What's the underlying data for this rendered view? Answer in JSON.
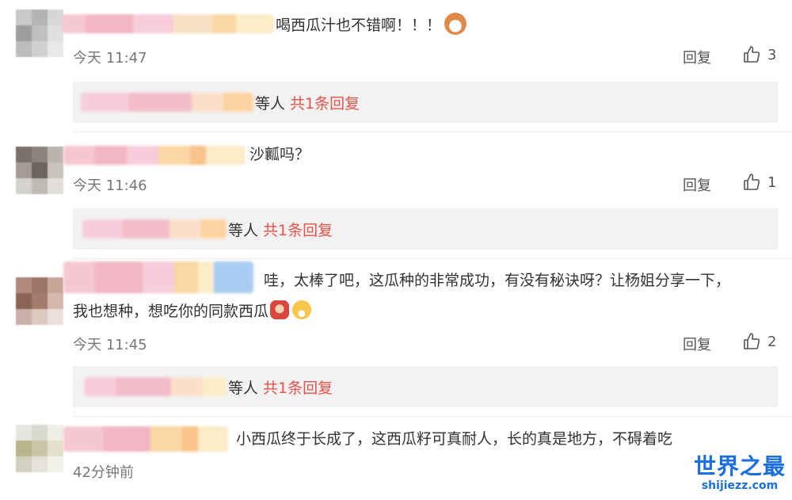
{
  "comments": [
    {
      "text": "喝西瓜汁也不错啊！！！",
      "time": "今天 11:47",
      "reply_label": "回复",
      "likes": "3",
      "emoji": "cat-face",
      "sub": {
        "suffix": "等人 ",
        "link": "共1条回复"
      }
    },
    {
      "text": "沙瓤吗？",
      "time": "今天 11:46",
      "reply_label": "回复",
      "likes": "1",
      "sub": {
        "suffix": "等人 ",
        "link": "共1条回复"
      }
    },
    {
      "text_line1": "哇，太棒了吧，这瓜种的非常成功，有没有秘诀呀？让杨姐分享一下，",
      "text_line2": "我也想种，想吃你的同款西瓜",
      "emojis": [
        "watermelon-character",
        "laughing-face"
      ],
      "time": "今天 11:45",
      "reply_label": "回复",
      "likes": "2",
      "sub": {
        "suffix": "等人 ",
        "link": "共1条回复"
      }
    },
    {
      "text": "小西瓜终于长成了，这西瓜籽可真耐人，长的真是地方，不碍着吃",
      "time": "42分钟前"
    }
  ],
  "watermark": {
    "title": "世界之最",
    "domain": "shijiezz.com"
  },
  "colors": {
    "accent": "#e8524a",
    "text": "#333333",
    "meta": "#777777",
    "box": "#f2f2f2"
  }
}
